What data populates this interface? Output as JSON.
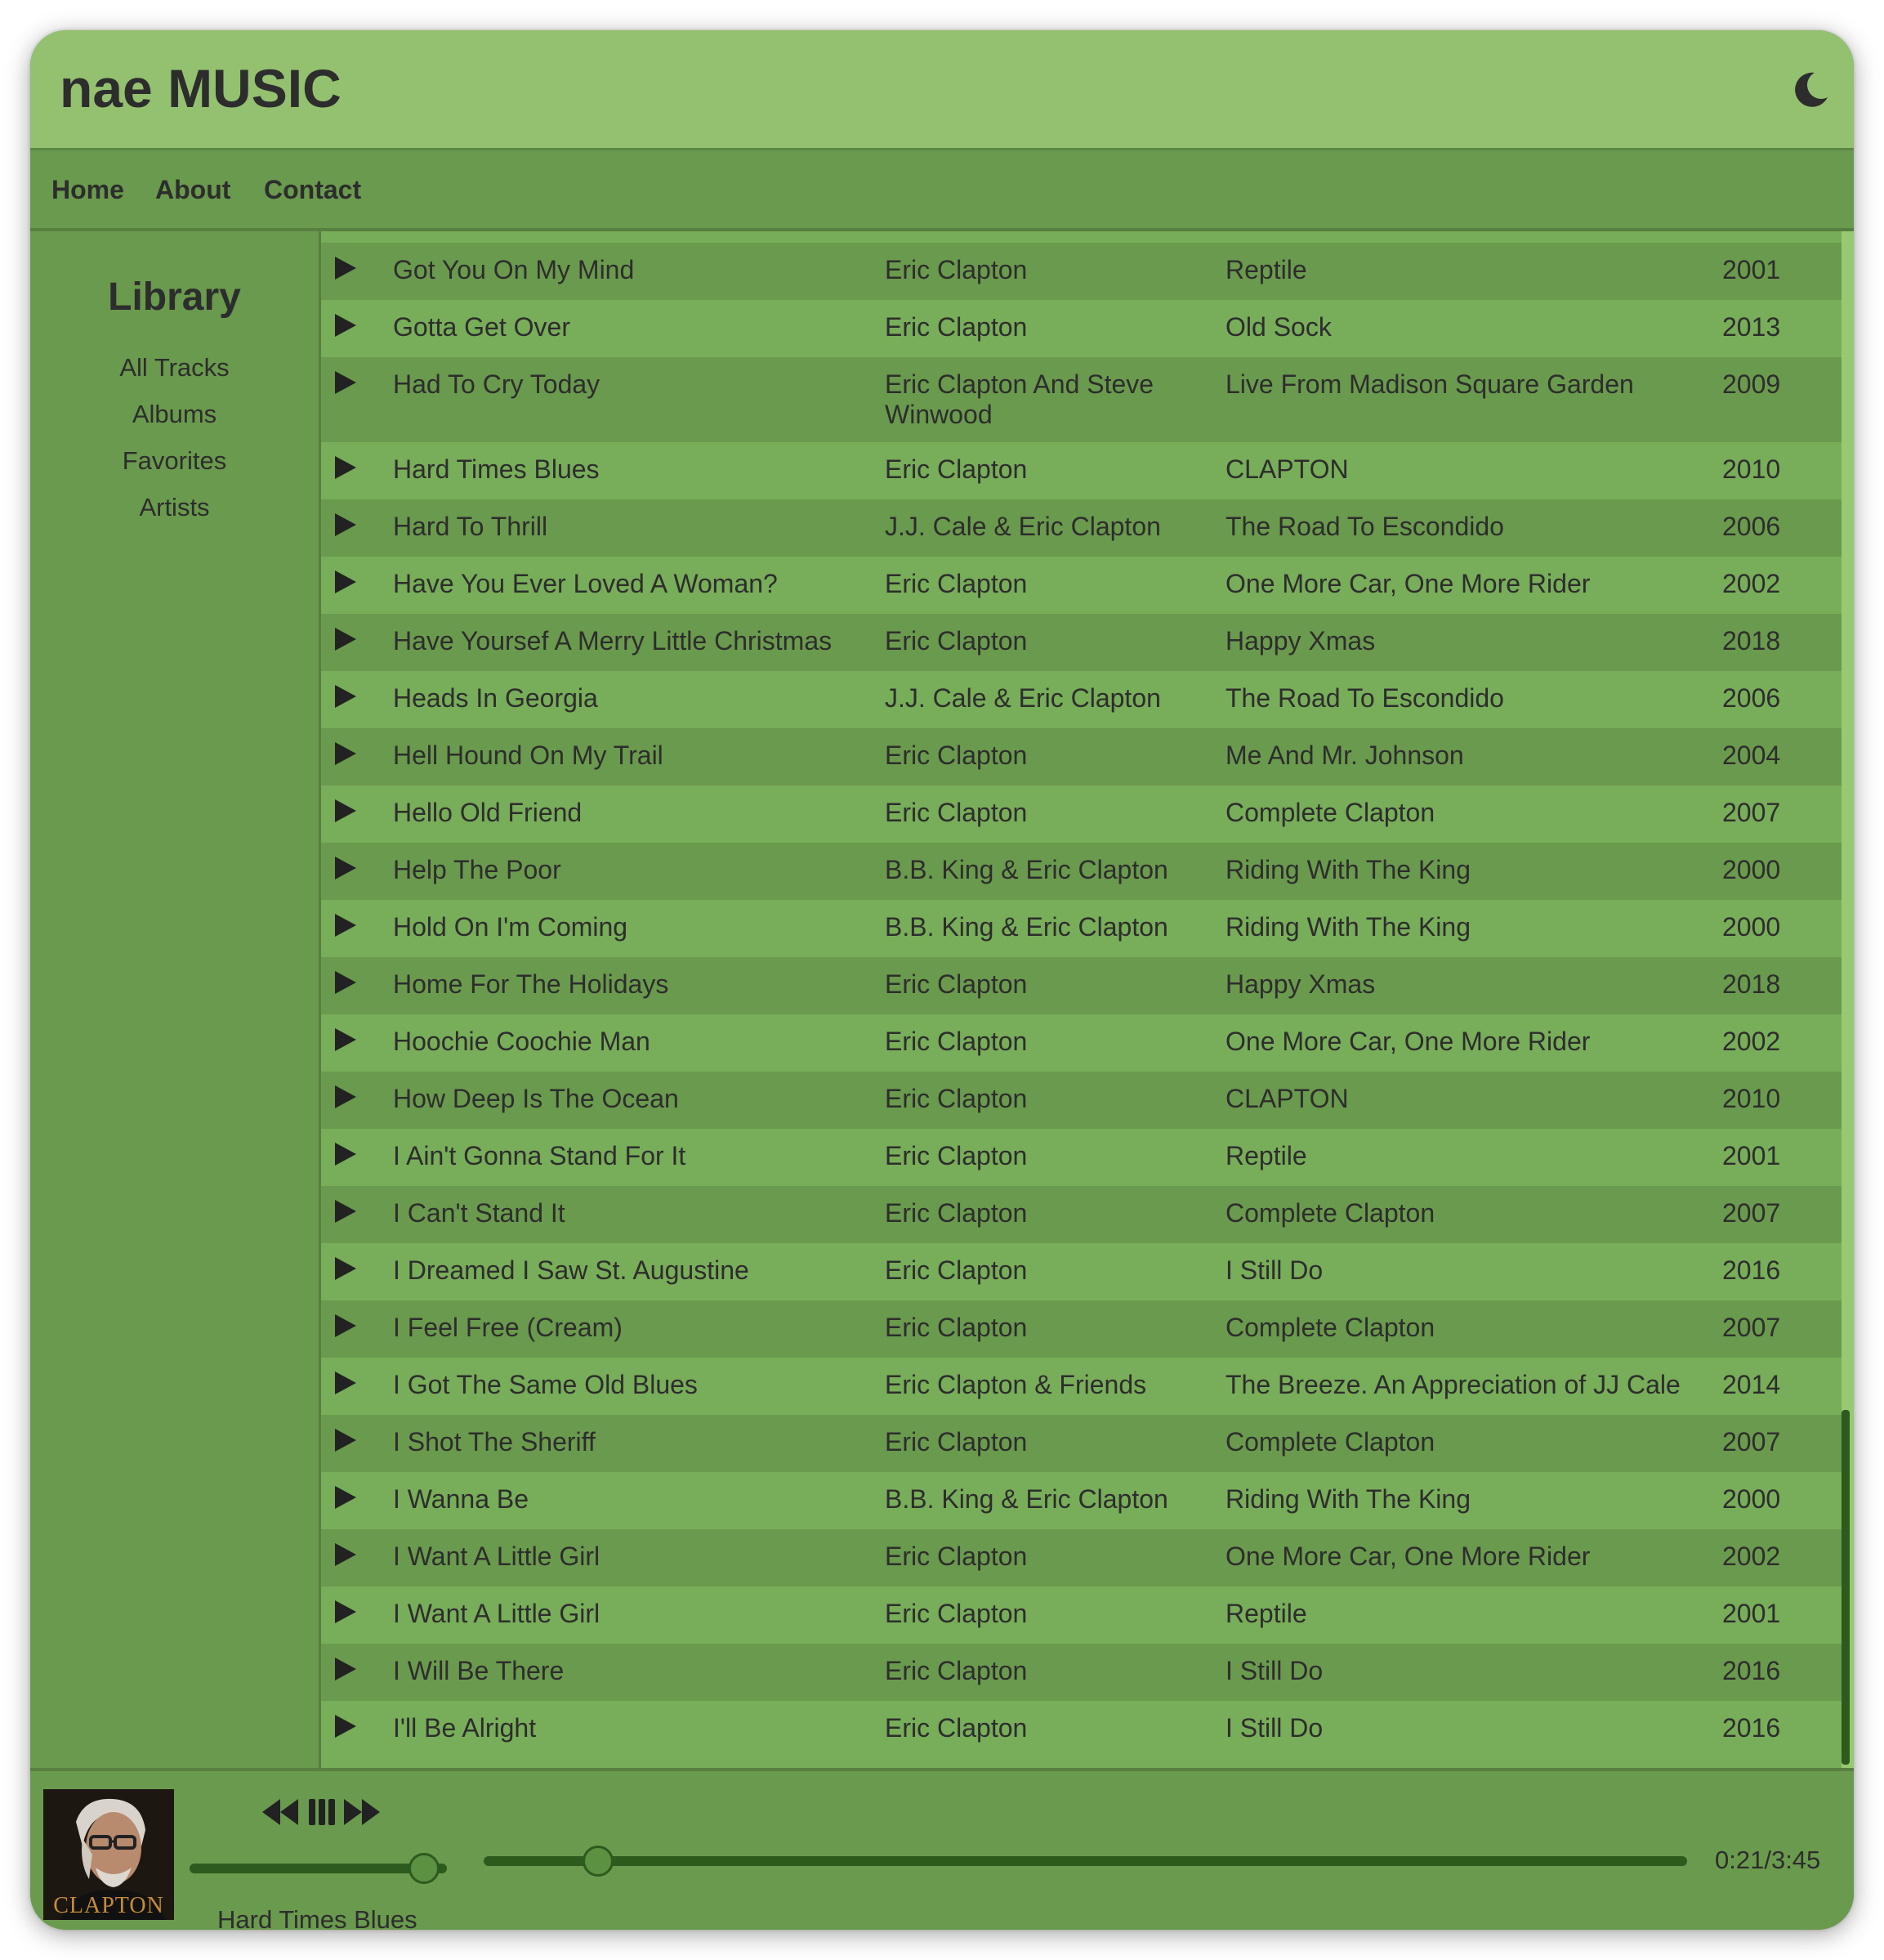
{
  "app": {
    "title": "nae MUSIC"
  },
  "header": {
    "theme_toggle_icon": "moon-icon"
  },
  "nav": {
    "items": [
      "Home",
      "About",
      "Contact"
    ]
  },
  "sidebar": {
    "title": "Library",
    "items": [
      "All Tracks",
      "Albums",
      "Favorites",
      "Artists"
    ]
  },
  "tracks": [
    {
      "title": "Got You On My Mind",
      "artist": "Eric Clapton",
      "album": "Reptile",
      "year": "2001"
    },
    {
      "title": "Gotta Get Over",
      "artist": "Eric Clapton",
      "album": "Old Sock",
      "year": "2013"
    },
    {
      "title": "Had To Cry Today",
      "artist": "Eric Clapton And Steve Winwood",
      "album": "Live From Madison Square Garden",
      "year": "2009"
    },
    {
      "title": "Hard Times Blues",
      "artist": "Eric Clapton",
      "album": "CLAPTON",
      "year": "2010"
    },
    {
      "title": "Hard To Thrill",
      "artist": "J.J. Cale & Eric Clapton",
      "album": "The Road To Escondido",
      "year": "2006"
    },
    {
      "title": "Have You Ever Loved A Woman?",
      "artist": "Eric Clapton",
      "album": "One More Car, One More Rider",
      "year": "2002"
    },
    {
      "title": "Have Yoursef A Merry Little Christmas",
      "artist": "Eric Clapton",
      "album": "Happy Xmas",
      "year": "2018"
    },
    {
      "title": "Heads In Georgia",
      "artist": "J.J. Cale & Eric Clapton",
      "album": "The Road To Escondido",
      "year": "2006"
    },
    {
      "title": "Hell Hound On My Trail",
      "artist": "Eric Clapton",
      "album": "Me And Mr. Johnson",
      "year": "2004"
    },
    {
      "title": "Hello Old Friend",
      "artist": "Eric Clapton",
      "album": "Complete Clapton",
      "year": "2007"
    },
    {
      "title": "Help The Poor",
      "artist": "B.B. King & Eric Clapton",
      "album": "Riding With The King",
      "year": "2000"
    },
    {
      "title": "Hold On I'm Coming",
      "artist": "B.B. King & Eric Clapton",
      "album": "Riding With The King",
      "year": "2000"
    },
    {
      "title": "Home For The Holidays",
      "artist": "Eric Clapton",
      "album": "Happy Xmas",
      "year": "2018"
    },
    {
      "title": "Hoochie Coochie Man",
      "artist": "Eric Clapton",
      "album": "One More Car, One More Rider",
      "year": "2002"
    },
    {
      "title": "How Deep Is The Ocean",
      "artist": "Eric Clapton",
      "album": "CLAPTON",
      "year": "2010"
    },
    {
      "title": "I Ain't Gonna Stand For It",
      "artist": "Eric Clapton",
      "album": "Reptile",
      "year": "2001"
    },
    {
      "title": "I Can't Stand It",
      "artist": "Eric Clapton",
      "album": "Complete Clapton",
      "year": "2007"
    },
    {
      "title": "I Dreamed I Saw St. Augustine",
      "artist": "Eric Clapton",
      "album": "I Still Do",
      "year": "2016"
    },
    {
      "title": "I Feel Free (Cream)",
      "artist": "Eric Clapton",
      "album": "Complete Clapton",
      "year": "2007"
    },
    {
      "title": "I Got The Same Old Blues",
      "artist": "Eric Clapton & Friends",
      "album": "The Breeze. An Appreciation of JJ Cale",
      "year": "2014"
    },
    {
      "title": "I Shot The Sheriff",
      "artist": "Eric Clapton",
      "album": "Complete Clapton",
      "year": "2007"
    },
    {
      "title": "I Wanna Be",
      "artist": "B.B. King & Eric Clapton",
      "album": "Riding With The King",
      "year": "2000"
    },
    {
      "title": "I Want A Little Girl",
      "artist": "Eric Clapton",
      "album": "One More Car, One More Rider",
      "year": "2002"
    },
    {
      "title": "I Want A Little Girl",
      "artist": "Eric Clapton",
      "album": "Reptile",
      "year": "2001"
    },
    {
      "title": "I Will Be There",
      "artist": "Eric Clapton",
      "album": "I Still Do",
      "year": "2016"
    },
    {
      "title": "I'll Be Alright",
      "artist": "Eric Clapton",
      "album": "I Still Do",
      "year": "2016"
    }
  ],
  "player": {
    "now_playing_title": "Hard Times Blues",
    "album_art_text": "CLAPTON",
    "time": "0:21/3:45",
    "progress_fraction": 0.0933,
    "volume_fraction": 0.9,
    "controls": [
      "previous-icon",
      "pause-icon",
      "next-icon"
    ]
  },
  "colors": {
    "header_bg": "#94c170",
    "body_bg": "#6a9a4d",
    "row_light": "#78ad59",
    "row_dark": "#6a9a4d",
    "accent_dark": "#2d5a1d",
    "text": "#2d2d2d"
  }
}
